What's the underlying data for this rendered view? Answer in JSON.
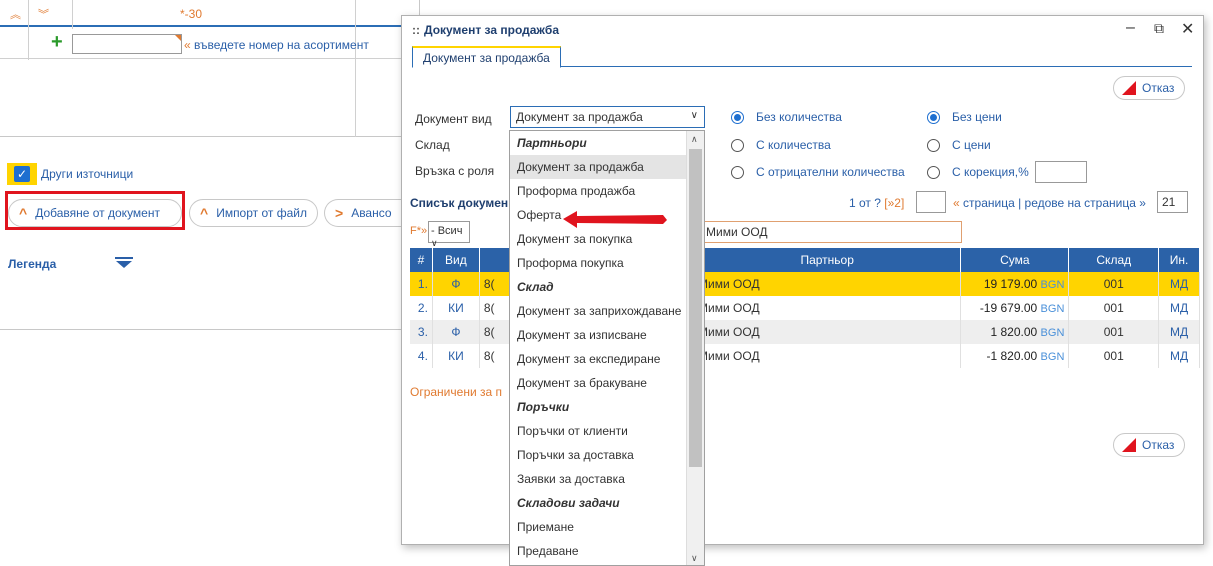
{
  "background": {
    "row1_value": "*-30",
    "row2_hint_quote": "«",
    "row2_hint": "въведете номер на асортимент",
    "other_sources_label": "Други източници",
    "add_document_label": "Добавяне от документ",
    "import_file_label": "Импорт от файл",
    "advance_label": "Авансо",
    "legend_label": "Легенда"
  },
  "dialog": {
    "title": "Документ за продажба",
    "tab_label": "Документ за продажба",
    "cancel_label": "Отказ",
    "doc_type_label": "Документ вид",
    "doc_type_value": "Документ за продажба",
    "warehouse_label": "Склад",
    "role_label": "Връзка с роля",
    "radios_qty": [
      {
        "label": "Без количества",
        "checked": true
      },
      {
        "label": "С количества",
        "checked": false
      },
      {
        "label": "С отрицателни количества",
        "checked": false
      }
    ],
    "radios_price": [
      {
        "label": "Без цени",
        "checked": true
      },
      {
        "label": "С цени",
        "checked": false
      },
      {
        "label": "С корекция,%",
        "checked": false
      }
    ],
    "list_title": "Списък докумен",
    "pager": {
      "page_info": "1 от ?",
      "next": "[»2]",
      "per_page_quote": "«",
      "per_page_text": "страница | редове на страница »",
      "per_page_value": "21"
    },
    "filter": {
      "label": "F*»",
      "select_value": "- Всич",
      "partner_value": "Мими ООД"
    },
    "table": {
      "headers": [
        "#",
        "Вид",
        "Партньор",
        "Сума",
        "Склад",
        "Ин."
      ],
      "rows": [
        {
          "n": "1.",
          "vid": "Ф",
          "no": "8(",
          "partner": "Мими ООД",
          "sum": "19 179.00",
          "cur": "BGN",
          "wh": "001",
          "in": "МД"
        },
        {
          "n": "2.",
          "vid": "КИ",
          "no": "8(",
          "partner": "Мими ООД",
          "sum": "-19 679.00",
          "cur": "BGN",
          "wh": "001",
          "in": "МД"
        },
        {
          "n": "3.",
          "vid": "Ф",
          "no": "8(",
          "partner": "Мими ООД",
          "sum": "1 820.00",
          "cur": "BGN",
          "wh": "001",
          "in": "МД"
        },
        {
          "n": "4.",
          "vid": "КИ",
          "no": "8(",
          "partner": "Мими ООД",
          "sum": "-1 820.00",
          "cur": "BGN",
          "wh": "001",
          "in": "МД"
        }
      ]
    },
    "limited_text": "Ограничени за п"
  },
  "dropdown": {
    "items": [
      {
        "label": "Партньори",
        "group": true
      },
      {
        "label": "Документ за продажба",
        "highlight": true
      },
      {
        "label": "Проформа продажба"
      },
      {
        "label": "Оферта"
      },
      {
        "label": "Документ за покупка"
      },
      {
        "label": "Проформа покупка"
      },
      {
        "label": "Склад",
        "group": true
      },
      {
        "label": "Документ за заприхождаване"
      },
      {
        "label": "Документ за изписване"
      },
      {
        "label": "Документ за експедиране"
      },
      {
        "label": "Документ за бракуване"
      },
      {
        "label": "Поръчки",
        "group": true
      },
      {
        "label": "Поръчки от клиенти"
      },
      {
        "label": "Поръчки за доставка"
      },
      {
        "label": "Заявки за доставка"
      },
      {
        "label": "Складови задачи",
        "group": true
      },
      {
        "label": "Приемане"
      },
      {
        "label": "Предаване"
      }
    ]
  },
  "colors": {
    "accent_blue": "#2b62a8",
    "highlight_yellow": "#ffd400",
    "alert_red": "#e0141e",
    "orange": "#e07a30"
  }
}
